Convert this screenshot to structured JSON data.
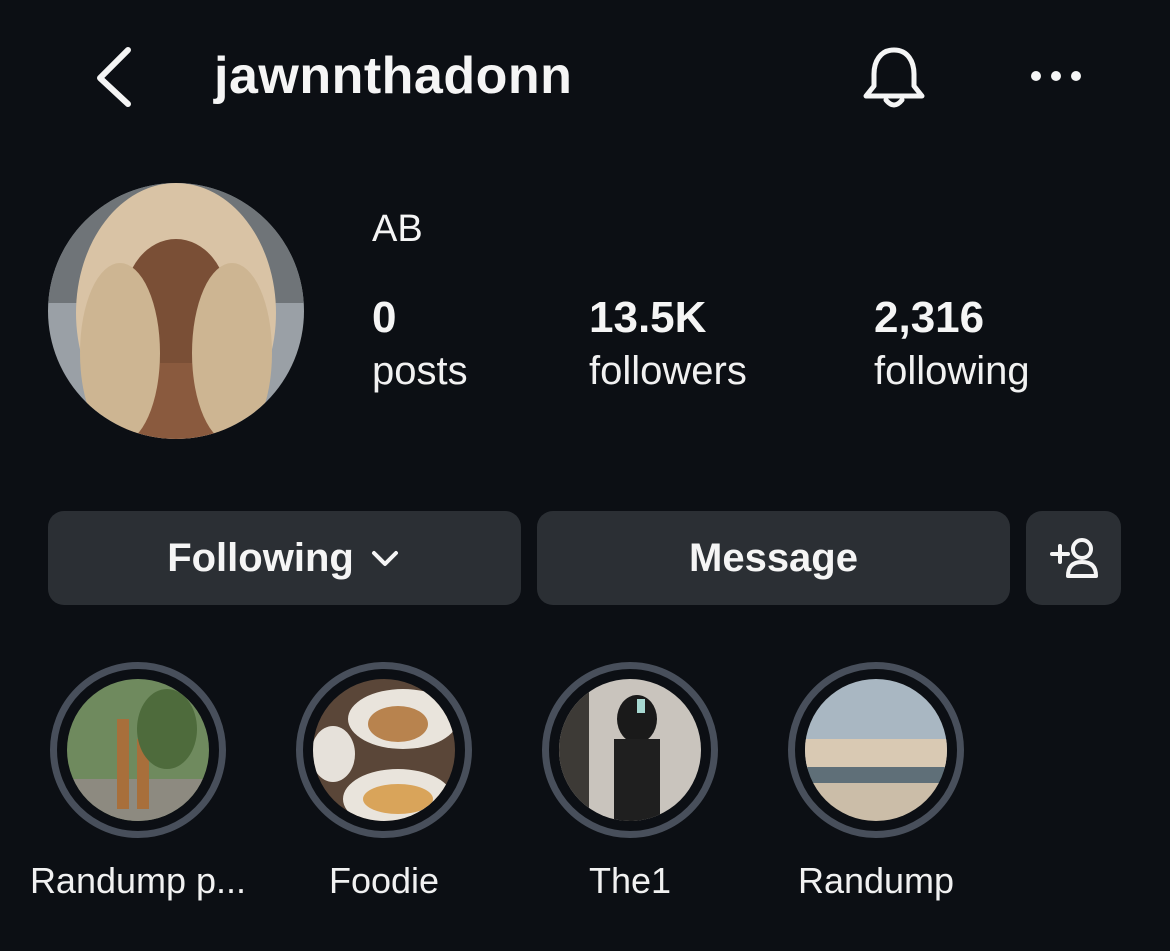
{
  "header": {
    "username": "jawnnthadonn",
    "back_icon": "chevron-left-icon",
    "notifications_icon": "bell-icon",
    "more_icon": "ellipsis-icon"
  },
  "profile": {
    "display_name": "AB",
    "stats": [
      {
        "value": "0",
        "label": "posts"
      },
      {
        "value": "13.5K",
        "label": "followers"
      },
      {
        "value": "2,316",
        "label": "following"
      }
    ]
  },
  "actions": {
    "following_label": "Following",
    "message_label": "Message",
    "add_user_icon": "add-user-icon"
  },
  "highlights": [
    {
      "label": "Randump p..."
    },
    {
      "label": "Foodie"
    },
    {
      "label": "The1"
    },
    {
      "label": "Randump"
    }
  ],
  "colors": {
    "background": "#0c0f14",
    "button_bg": "#2b2f34",
    "ring": "#484f5b"
  }
}
